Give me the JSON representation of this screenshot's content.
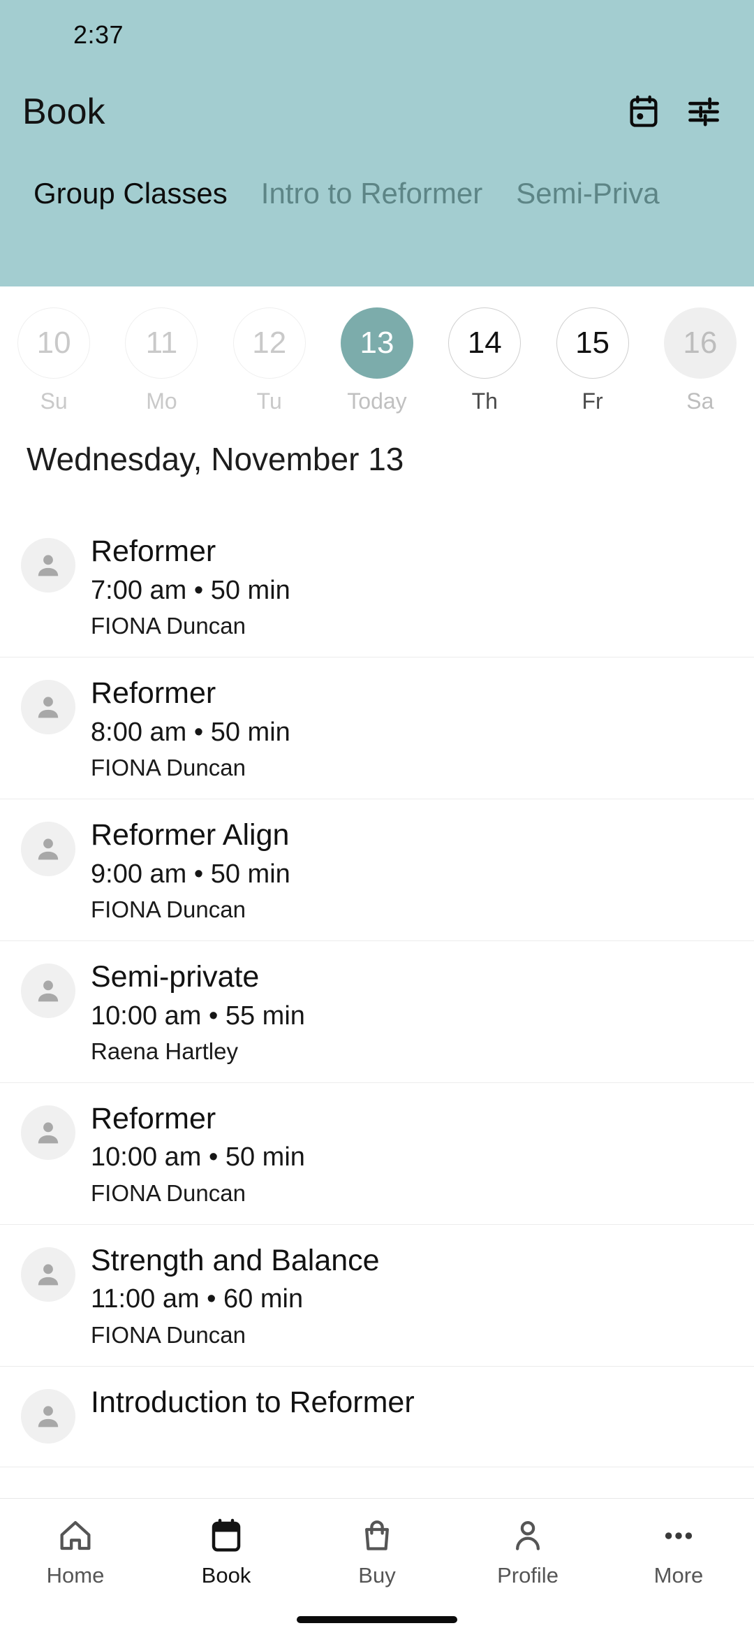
{
  "statusbar": {
    "time": "2:37"
  },
  "appbar": {
    "title": "Book",
    "calendar_icon": "calendar-icon",
    "filter_icon": "filter-sliders-icon"
  },
  "tabs": [
    {
      "label": "Group Classes",
      "active": true
    },
    {
      "label": "Intro to Reformer",
      "active": false
    },
    {
      "label": "Semi-Priva",
      "active": false
    }
  ],
  "datestrip": [
    {
      "date": "10",
      "label": "Su",
      "state": "past"
    },
    {
      "date": "11",
      "label": "Mo",
      "state": "past"
    },
    {
      "date": "12",
      "label": "Tu",
      "state": "past"
    },
    {
      "date": "13",
      "label": "Today",
      "state": "selected"
    },
    {
      "date": "14",
      "label": "Th",
      "state": "future"
    },
    {
      "date": "15",
      "label": "Fr",
      "state": "future"
    },
    {
      "date": "16",
      "label": "Sa",
      "state": "disabled"
    }
  ],
  "date_heading": "Wednesday, November 13",
  "classes": [
    {
      "title": "Reformer",
      "time": "7:00 am • 50 min",
      "instructor": "FIONA Duncan"
    },
    {
      "title": "Reformer",
      "time": "8:00 am • 50 min",
      "instructor": "FIONA Duncan"
    },
    {
      "title": "Reformer Align",
      "time": "9:00 am • 50 min",
      "instructor": "FIONA Duncan"
    },
    {
      "title": "Semi-private",
      "time": "10:00 am • 55 min",
      "instructor": "Raena Hartley"
    },
    {
      "title": "Reformer",
      "time": "10:00 am • 50 min",
      "instructor": "FIONA Duncan"
    },
    {
      "title": "Strength and Balance",
      "time": "11:00 am • 60 min",
      "instructor": "FIONA Duncan"
    },
    {
      "title": "Introduction to Reformer",
      "time": "",
      "instructor": ""
    }
  ],
  "bottomnav": [
    {
      "label": "Home",
      "icon": "home-icon",
      "active": false
    },
    {
      "label": "Book",
      "icon": "calendar-icon",
      "active": true
    },
    {
      "label": "Buy",
      "icon": "bag-icon",
      "active": false
    },
    {
      "label": "Profile",
      "icon": "person-icon",
      "active": false
    },
    {
      "label": "More",
      "icon": "ellipsis-icon",
      "active": false
    }
  ],
  "colors": {
    "header_teal": "#a3cdd0",
    "selected_teal": "#7cacab",
    "tab_inactive": "#5d8586"
  }
}
